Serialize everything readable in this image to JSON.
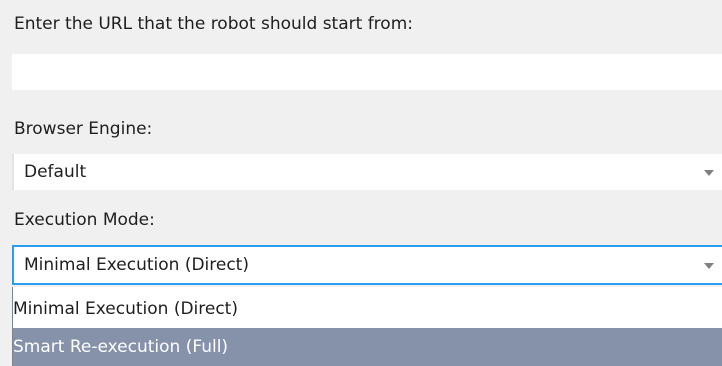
{
  "url_section": {
    "label": "Enter the URL that the robot should start from:",
    "value": "",
    "placeholder": ""
  },
  "browser_engine": {
    "label": "Browser Engine:",
    "selected": "Default"
  },
  "execution_mode": {
    "label": "Execution Mode:",
    "selected": "Minimal Execution (Direct)",
    "options": [
      "Minimal Execution (Direct)",
      "Smart Re-execution (Full)"
    ],
    "highlighted_option_index": 1
  },
  "colors": {
    "background": "#f0f0f0",
    "input_background": "#ffffff",
    "focus_border": "#2a9df0",
    "highlight": "#8592aa",
    "text": "#1e1e1e"
  },
  "icons": {
    "dropdown_arrow": "chevron-down-icon"
  }
}
